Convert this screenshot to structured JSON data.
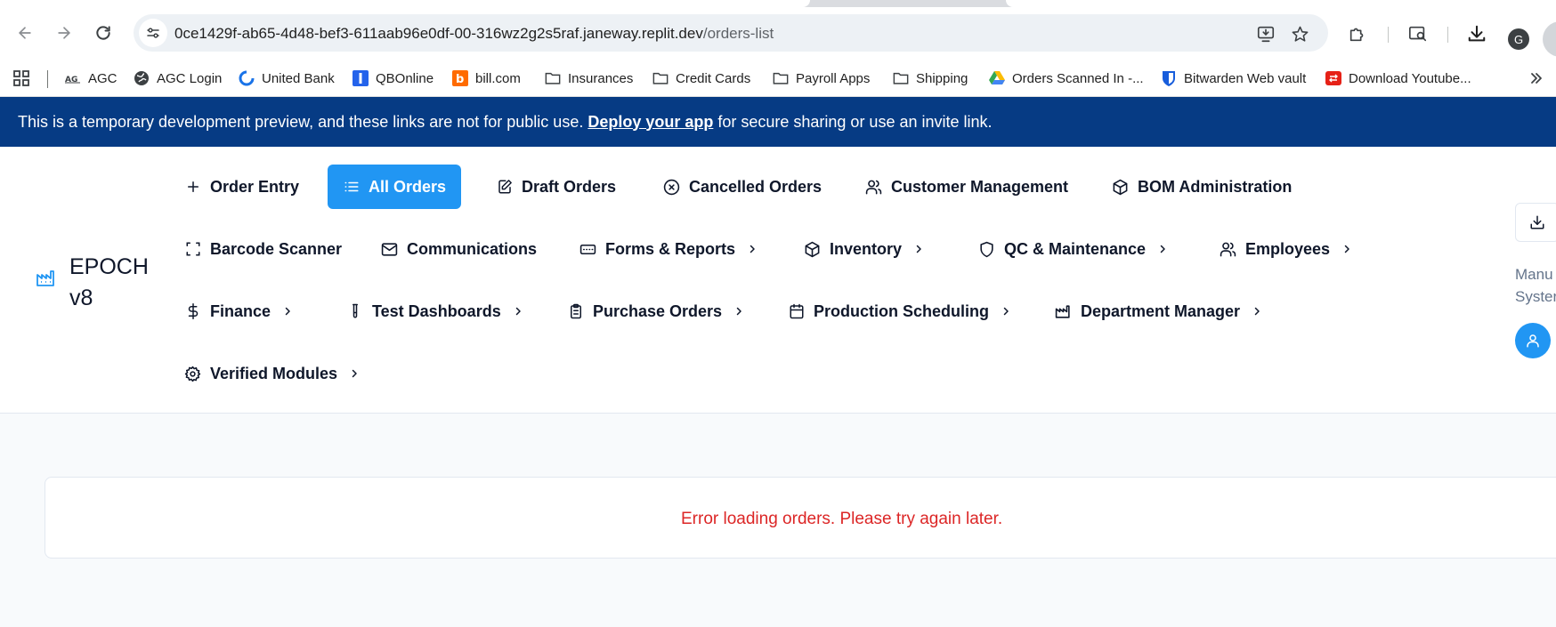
{
  "browser": {
    "url_host": "0ce1429f-ab65-4d48-bef3-611aab96e0df-00-316wz2g2s5raf.janeway.replit.dev",
    "url_path": "/orders-list",
    "profile_initial": "G"
  },
  "bookmarks": [
    {
      "label": "AGC",
      "icon": "agc-logo"
    },
    {
      "label": "AGC Login",
      "icon": "globe-icon"
    },
    {
      "label": "United Bank",
      "icon": "united-bank-logo"
    },
    {
      "label": "QBOnline",
      "icon": "qbo-logo"
    },
    {
      "label": "bill.com",
      "icon": "bill-logo"
    },
    {
      "label": "Insurances",
      "icon": "folder-icon"
    },
    {
      "label": "Credit Cards",
      "icon": "folder-icon"
    },
    {
      "label": "Payroll Apps",
      "icon": "folder-icon"
    },
    {
      "label": "Shipping",
      "icon": "folder-icon"
    },
    {
      "label": "Orders Scanned In -...",
      "icon": "drive-icon"
    },
    {
      "label": "Bitwarden Web vault",
      "icon": "bitwarden-icon"
    },
    {
      "label": "Download Youtube...",
      "icon": "youtube-download-icon"
    }
  ],
  "banner": {
    "text_before": "This is a temporary development preview, and these links are not for public use.",
    "link": "Deploy your app",
    "text_after": "for secure sharing or use an invite link."
  },
  "app": {
    "brand": "EPOCH v8",
    "nav": [
      {
        "label": "Order Entry",
        "icon": "plus-icon"
      },
      {
        "label": "All Orders",
        "icon": "list-icon",
        "active": true
      },
      {
        "label": "Draft Orders",
        "icon": "edit-icon"
      },
      {
        "label": "Cancelled Orders",
        "icon": "x-circle-icon"
      },
      {
        "label": "Customer Management",
        "icon": "users-icon"
      },
      {
        "label": "BOM Administration",
        "icon": "package-icon"
      },
      {
        "label": "Barcode Scanner",
        "icon": "scan-icon"
      },
      {
        "label": "Communications",
        "icon": "mail-icon"
      },
      {
        "label": "Forms & Reports",
        "icon": "form-icon"
      },
      {
        "label": "Inventory",
        "icon": "package-icon"
      },
      {
        "label": "QC & Maintenance",
        "icon": "shield-icon"
      },
      {
        "label": "Employees",
        "icon": "users-icon"
      },
      {
        "label": "Finance",
        "icon": "dollar-icon"
      },
      {
        "label": "Test Dashboards",
        "icon": "test-tube-icon"
      },
      {
        "label": "Purchase Orders",
        "icon": "clipboard-icon"
      },
      {
        "label": "Production Scheduling",
        "icon": "calendar-icon"
      },
      {
        "label": "Department Manager",
        "icon": "factory-icon"
      },
      {
        "label": "Verified Modules",
        "icon": "gear-icon"
      }
    ],
    "system_label_line1": "Manu",
    "system_label_line2": "Syster"
  },
  "main": {
    "error_message": "Error loading orders. Please try again later."
  },
  "colors": {
    "banner_bg": "#063b84",
    "accent": "#2196f3",
    "error": "#dc2626"
  }
}
